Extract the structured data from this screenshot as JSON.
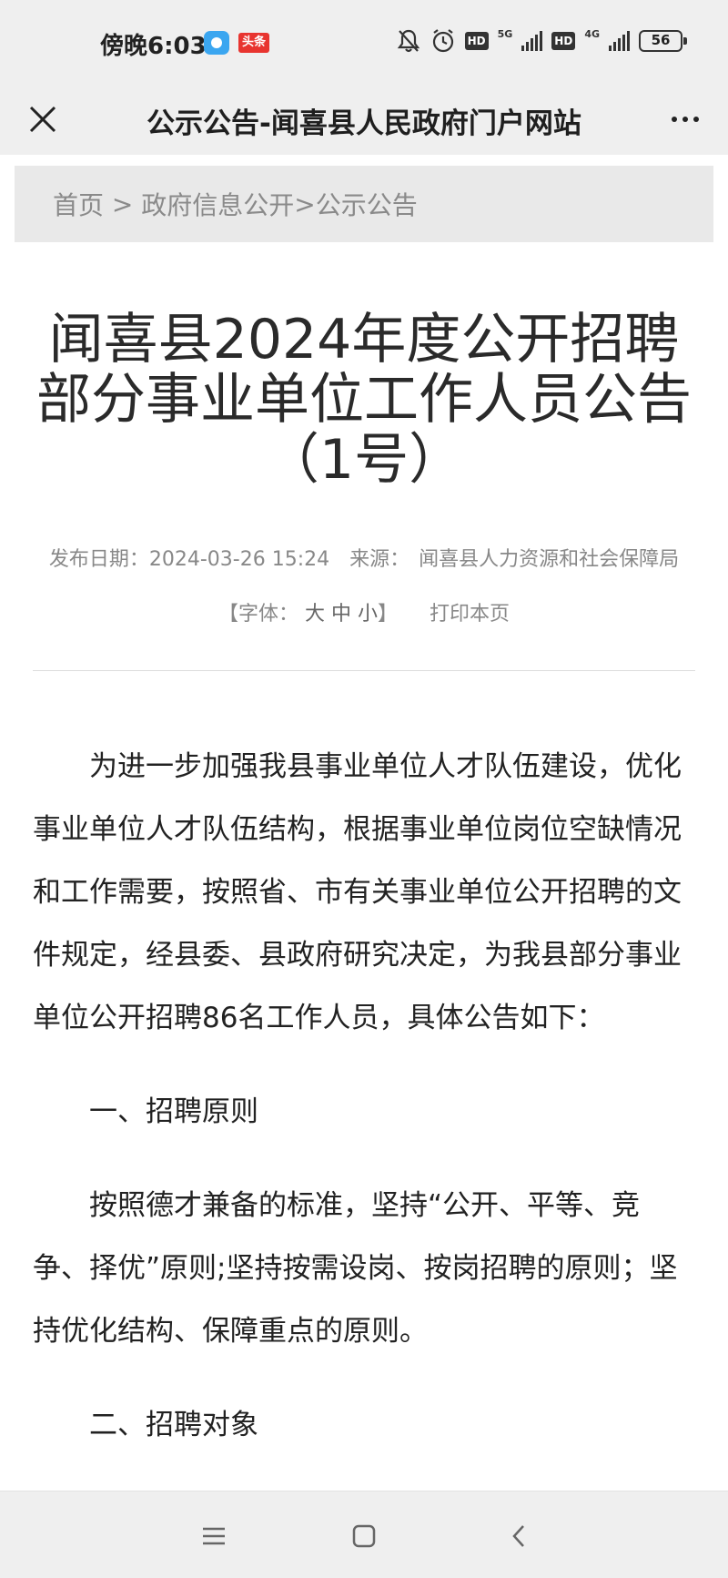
{
  "status_bar": {
    "time": "傍晚6:03",
    "app_badge": "头条",
    "hd_label": "HD",
    "net1": "5G",
    "net2": "4G",
    "battery": "56"
  },
  "app_bar": {
    "title": "公示公告-闻喜县人民政府门户网站"
  },
  "breadcrumb": {
    "home": "首页",
    "sep1": " > ",
    "section": "政府信息公开",
    "sep2": ">",
    "current": "公示公告"
  },
  "article": {
    "title": "闻喜县2024年度公开招聘部分事业单位工作人员公告（1号）",
    "publish_label": "发布日期：",
    "publish_date": "2024-03-26 15:24",
    "source_label": "来源：",
    "source": "闻喜县人力资源和社会保障局",
    "font_open": "【字体：",
    "font_large": "大",
    "font_medium": "中",
    "font_small": "小",
    "font_close": "】",
    "print": "打印本页",
    "intro": "为进一步加强我县事业单位人才队伍建设，优化事业单位人才队伍结构，根据事业单位岗位空缺情况和工作需要，按照省、市有关事业单位公开招聘的文件规定，经县委、县政府研究决定，为我县部分事业单位公开招聘86名工作人员，具体公告如下：",
    "section1_title": "一、招聘原则",
    "section1_body": "按照德才兼备的标准，坚持“公开、平等、竞争、择优”原则;坚持按需设岗、按岗招聘的原则；坚持优化结构、保障重点的原则。",
    "section2_title": "二、招聘对象"
  }
}
